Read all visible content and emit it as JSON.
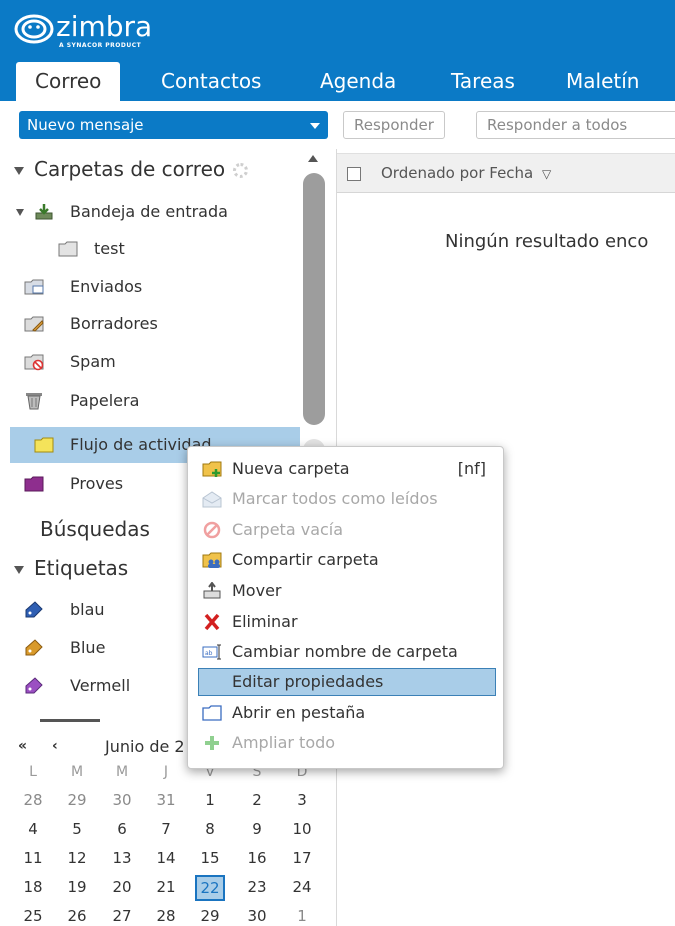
{
  "brand": {
    "name": "zimbra",
    "tagline": "A SYNACOR PRODUCT",
    "color": "#0b7ac6"
  },
  "app_tabs": [
    {
      "label": "Correo",
      "active": true
    },
    {
      "label": "Contactos",
      "active": false
    },
    {
      "label": "Agenda",
      "active": false
    },
    {
      "label": "Tareas",
      "active": false
    },
    {
      "label": "Maletín",
      "active": false
    }
  ],
  "toolbar": {
    "new_message": "Nuevo mensaje",
    "reply": "Responder",
    "reply_all": "Responder a todos"
  },
  "sidebar": {
    "mail_folders_header": "Carpetas de correo",
    "folders": [
      {
        "label": "Bandeja de entrada",
        "icon": "inbox-icon"
      },
      {
        "label": "test",
        "icon": "folder-icon"
      },
      {
        "label": "Enviados",
        "icon": "sent-icon"
      },
      {
        "label": "Borradores",
        "icon": "drafts-icon"
      },
      {
        "label": "Spam",
        "icon": "spam-icon"
      },
      {
        "label": "Papelera",
        "icon": "trash-icon"
      },
      {
        "label": "Flujo de actividad",
        "icon": "folder-icon",
        "selected": true
      },
      {
        "label": "Proves",
        "icon": "purple-folder-icon"
      }
    ],
    "searches_header": "Búsquedas",
    "tags_header": "Etiquetas",
    "tags": [
      {
        "label": "blau",
        "color": "#2f5fb3"
      },
      {
        "label": "Blue",
        "color": "#d99a2b"
      },
      {
        "label": "Vermell",
        "color": "#9b4fc2"
      }
    ]
  },
  "mini_calendar": {
    "month_label": "Junio de 2",
    "prev_year": "«",
    "prev_month": "‹",
    "weekdays": [
      "L",
      "M",
      "M",
      "J",
      "V",
      "S",
      "D"
    ],
    "weeks": [
      [
        {
          "d": "28",
          "dim": true
        },
        {
          "d": "29",
          "dim": true
        },
        {
          "d": "30",
          "dim": true
        },
        {
          "d": "31",
          "dim": true
        },
        {
          "d": "1"
        },
        {
          "d": "2"
        },
        {
          "d": "3"
        }
      ],
      [
        {
          "d": "4"
        },
        {
          "d": "5"
        },
        {
          "d": "6"
        },
        {
          "d": "7"
        },
        {
          "d": "8"
        },
        {
          "d": "9"
        },
        {
          "d": "10"
        }
      ],
      [
        {
          "d": "11"
        },
        {
          "d": "12"
        },
        {
          "d": "13"
        },
        {
          "d": "14"
        },
        {
          "d": "15"
        },
        {
          "d": "16"
        },
        {
          "d": "17"
        }
      ],
      [
        {
          "d": "18"
        },
        {
          "d": "19"
        },
        {
          "d": "20"
        },
        {
          "d": "21"
        },
        {
          "d": "22",
          "today": true
        },
        {
          "d": "23"
        },
        {
          "d": "24"
        }
      ],
      [
        {
          "d": "25"
        },
        {
          "d": "26"
        },
        {
          "d": "27"
        },
        {
          "d": "28"
        },
        {
          "d": "29"
        },
        {
          "d": "30"
        },
        {
          "d": "1",
          "dim": true
        }
      ]
    ]
  },
  "message_list": {
    "sort_label": "Ordenado por Fecha",
    "empty_text": "Ningún resultado enco"
  },
  "context_menu": {
    "items": [
      {
        "label": "Nueva carpeta",
        "shortcut": "[nf]",
        "icon": "new-folder-icon",
        "disabled": false
      },
      {
        "label": "Marcar todos como leídos",
        "icon": "mark-read-icon",
        "disabled": true
      },
      {
        "label": "Carpeta vacía",
        "icon": "empty-folder-icon",
        "disabled": true
      },
      {
        "label": "Compartir carpeta",
        "icon": "share-folder-icon",
        "disabled": false
      },
      {
        "label": "Mover",
        "icon": "move-icon",
        "disabled": false
      },
      {
        "label": "Eliminar",
        "icon": "delete-icon",
        "disabled": false
      },
      {
        "label": "Cambiar nombre de carpeta",
        "icon": "rename-icon",
        "disabled": false
      },
      {
        "label": "Editar propiedades",
        "icon": "",
        "disabled": false,
        "highlighted": true
      },
      {
        "label": "Abrir en pestaña",
        "icon": "open-tab-icon",
        "disabled": false
      },
      {
        "label": "Ampliar todo",
        "icon": "expand-all-icon",
        "disabled": true
      }
    ]
  }
}
